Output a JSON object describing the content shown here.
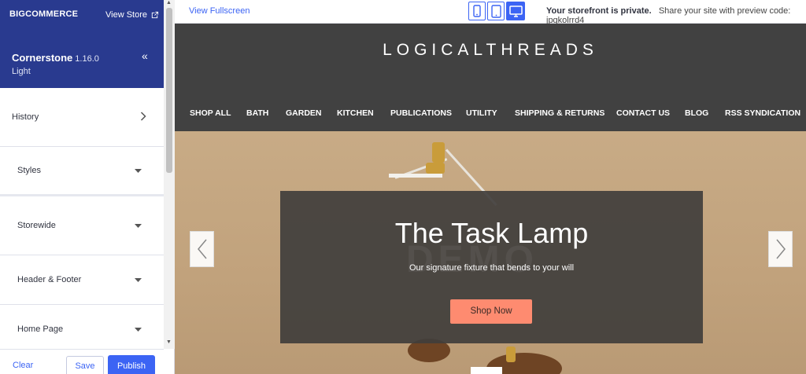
{
  "sidebar": {
    "brand_logo": "BIGCOMMERCE",
    "view_store_label": "View Store",
    "theme_name": "Cornerstone",
    "theme_version": "1.16.0",
    "theme_variant": "Light",
    "items": [
      {
        "label": "History"
      },
      {
        "label": "Styles"
      },
      {
        "label": "Storewide"
      },
      {
        "label": "Header & Footer"
      },
      {
        "label": "Home Page"
      }
    ],
    "footer": {
      "clear_label": "Clear",
      "save_label": "Save",
      "publish_label": "Publish"
    }
  },
  "topbar": {
    "view_fullscreen_label": "View Fullscreen",
    "devices": [
      {
        "name": "mobile-icon",
        "active": false
      },
      {
        "name": "tablet-icon",
        "active": false
      },
      {
        "name": "desktop-icon",
        "active": true
      }
    ],
    "private_label": "Your storefront is private.",
    "share_label": "Share your site with preview code: jpqkolrrd4"
  },
  "store": {
    "logo": "LOGICALTHREADS",
    "nav": [
      "SHOP ALL",
      "BATH",
      "GARDEN",
      "KITCHEN",
      "PUBLICATIONS",
      "UTILITY",
      "SHIPPING & RETURNS",
      "CONTACT US",
      "BLOG",
      "RSS SYNDICATION"
    ],
    "hero": {
      "title": "The Task Lamp",
      "subtitle": "Our signature fixture that bends to your will",
      "button_label": "Shop Now",
      "watermark": "DEMO"
    }
  },
  "colors": {
    "brand_blue": "#293a8f",
    "accent_blue": "#3c64f4",
    "store_header": "#414141",
    "hero_button": "#fe8b70"
  }
}
